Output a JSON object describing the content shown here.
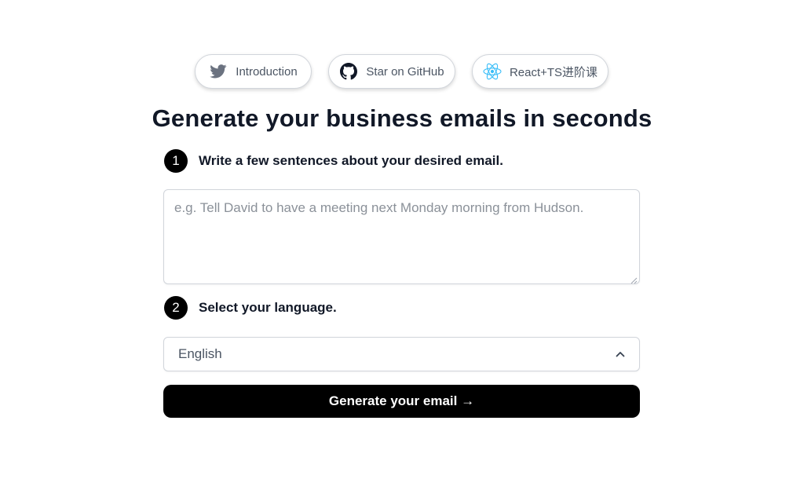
{
  "links": [
    {
      "label": "Introduction",
      "icon": "twitter-icon"
    },
    {
      "label": "Star on GitHub",
      "icon": "github-icon"
    },
    {
      "label": "React+TS进阶课",
      "icon": "react-icon"
    }
  ],
  "title": "Generate your business emails in seconds",
  "steps": [
    {
      "number": "1",
      "text": "Write a few sentences about your desired email."
    },
    {
      "number": "2",
      "text": "Select your language."
    }
  ],
  "prompt_input": {
    "value": "",
    "placeholder": "e.g. Tell David to have a meeting next Monday morning from Hudson."
  },
  "language_select": {
    "selected": "English",
    "icon": "chevron-up-icon"
  },
  "generate_button": {
    "label": "Generate your email →"
  },
  "colors": {
    "button_bg": "#000000",
    "twitter_icon": "#6b7280",
    "react_icon": "#38bdf8"
  }
}
